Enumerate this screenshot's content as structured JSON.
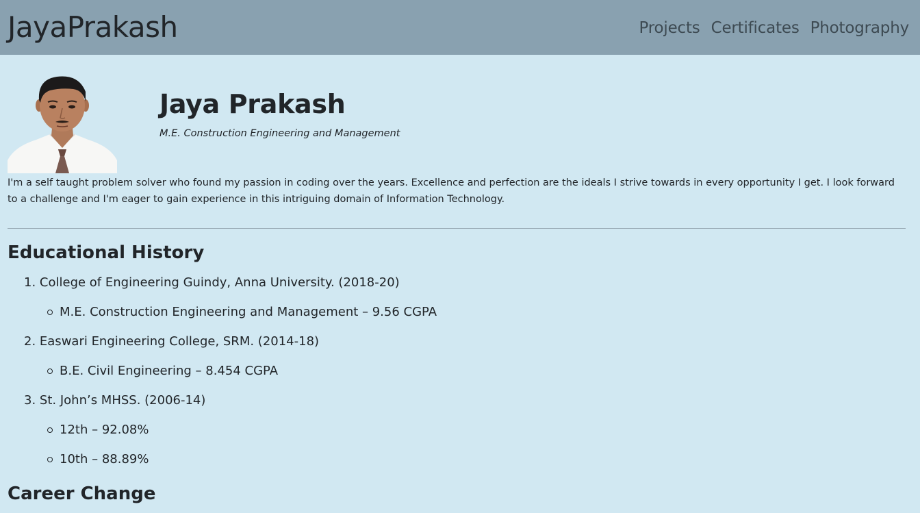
{
  "navbar": {
    "brand": "JayaPrakash",
    "links": [
      "Projects",
      "Certificates",
      "Photography"
    ]
  },
  "profile": {
    "name": "Jaya Prakash",
    "degree": "M.E. Construction Engineering and Management",
    "bio": "I'm a self taught problem solver who found my passion in coding over the years. Excellence and perfection are the ideals I strive towards in every opportunity I get. I look forward to a challenge and I'm eager to gain experience in this intriguing domain of Information Technology."
  },
  "education": {
    "title": "Educational History",
    "items": [
      {
        "label": "College of Engineering Guindy, Anna University. (2018-20)",
        "details": [
          "M.E. Construction Engineering and Management – 9.56 CGPA"
        ]
      },
      {
        "label": "Easwari Engineering College, SRM. (2014-18)",
        "details": [
          "B.E. Civil Engineering – 8.454 CGPA"
        ]
      },
      {
        "label": "St. John’s MHSS. (2006-14)",
        "details": [
          "12th – 92.08%",
          "10th – 88.89%"
        ]
      }
    ]
  },
  "career": {
    "title": "Career Change"
  }
}
